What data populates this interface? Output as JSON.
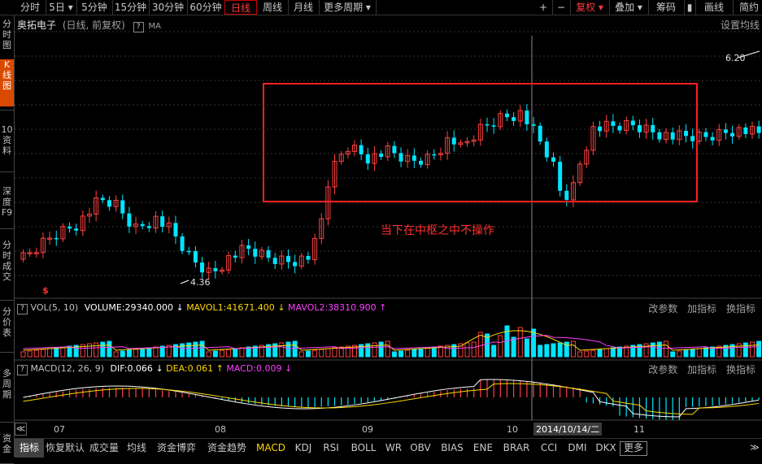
{
  "toolbar": {
    "periods": [
      {
        "label": "分时"
      },
      {
        "label": "5日 ▾"
      },
      {
        "label": "5分钟"
      },
      {
        "label": "15分钟"
      },
      {
        "label": "30分钟"
      },
      {
        "label": "60分钟"
      },
      {
        "label": "日线",
        "active": true
      },
      {
        "label": "周线"
      },
      {
        "label": "月线"
      },
      {
        "label": "更多周期 ▾"
      }
    ],
    "right": [
      {
        "label": "+"
      },
      {
        "label": "−"
      },
      {
        "label": "复权 ▾",
        "red": true
      },
      {
        "label": "叠加 ▾"
      },
      {
        "label": "筹码"
      },
      {
        "label": "▮"
      },
      {
        "label": "画线"
      },
      {
        "label": "简约"
      }
    ]
  },
  "sidebar": [
    {
      "label": "分时图"
    },
    {
      "label": "K线图",
      "active": true
    },
    {
      "label": "10资料"
    },
    {
      "label": "深度F9"
    },
    {
      "label": "分时成交"
    },
    {
      "label": "分价表"
    },
    {
      "label": "多周期"
    },
    {
      "label": "资金"
    }
  ],
  "main": {
    "stock_name": "奥拓电子",
    "subtitle": "(日线, 前复权)",
    "ma_label": "MA",
    "settings": "设置均线",
    "high_label": "6.20",
    "low_label": "4.36",
    "annotation": "当下在中枢之中不操作",
    "dollar": "$"
  },
  "vol": {
    "title": "VOL(5, 10)",
    "volume": "VOLUME:29340.000",
    "mavol1": "MAVOL1:41671.400",
    "mavol2": "MAVOL2:38310.900",
    "arrow_down": "↓",
    "arrow_up": "↑",
    "actions": [
      "改参数",
      "加指标",
      "换指标"
    ]
  },
  "macd": {
    "title": "MACD(12, 26, 9)",
    "dif": "DIF:0.066",
    "dea": "DEA:0.061",
    "macd": "MACD:0.009",
    "arrow_down": "↓",
    "arrow_up": "↑",
    "actions": [
      "改参数",
      "加指标",
      "换指标"
    ]
  },
  "xaxis": {
    "labels": [
      "07",
      "08",
      "09",
      "10",
      "11"
    ],
    "cursor_date": "2014/10/14/二",
    "nav": "≪",
    "nav_right": "≫"
  },
  "bottom_tabs": [
    {
      "label": "指标",
      "active": true
    },
    {
      "label": "恢复默认"
    },
    {
      "label": "成交量"
    },
    {
      "label": "均线"
    },
    {
      "label": "资金博弈"
    },
    {
      "label": "资金趋势"
    },
    {
      "label": "MACD",
      "yellow": true
    },
    {
      "label": "KDJ"
    },
    {
      "label": "RSI"
    },
    {
      "label": "BOLL"
    },
    {
      "label": "WR"
    },
    {
      "label": "OBV"
    },
    {
      "label": "BIAS"
    },
    {
      "label": "ENE"
    },
    {
      "label": "BRAR"
    },
    {
      "label": "CCI"
    },
    {
      "label": "DMI"
    },
    {
      "label": "DKX"
    },
    {
      "label": "更多"
    }
  ],
  "colors": {
    "up": "#ff4040",
    "down": "#00e5ff",
    "box": "#ff2020",
    "mavol1": "#ffd700",
    "mavol2": "#ff40ff",
    "dif": "#ffffff",
    "dea": "#ffd700"
  }
}
